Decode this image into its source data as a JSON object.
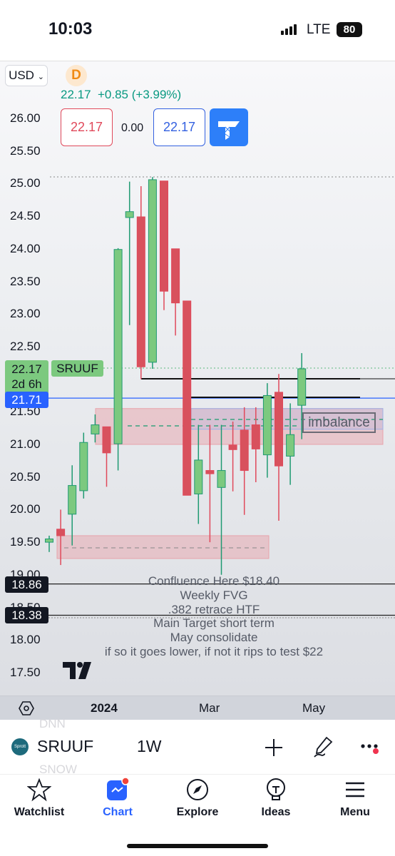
{
  "status_bar": {
    "time": "10:03",
    "network": "LTE",
    "battery": "80"
  },
  "header": {
    "currency": "USD",
    "interval_badge": "D",
    "last_price": "22.17",
    "change": "+0.85 (+3.99%)",
    "sell_price": "22.17",
    "spread": "0.00",
    "buy_price": "22.17"
  },
  "price_tags": {
    "last": "22.17",
    "countdown": "2d 6h",
    "symbol_tag": "SRUUF",
    "blue_line": "21.71",
    "level1": "18.86",
    "level2": "18.38"
  },
  "colors": {
    "up": "#7cc97f",
    "up_border": "#1f9a72",
    "down": "#d8515d",
    "accent": "#2962ff",
    "zone": "#e8a3ab"
  },
  "annotation": {
    "box_label": "imbalance",
    "note_lines": [
      "Confluence Here $18.40",
      "Weekly FVG",
      ".382 retrace HTF",
      "Main Target short term",
      "May consolidate",
      "if so it goes lower, if not it rips to test $22"
    ]
  },
  "chart_data": {
    "type": "candlestick",
    "interval": "1W",
    "y_ticks": [
      "26.00",
      "25.50",
      "25.00",
      "24.50",
      "24.00",
      "23.50",
      "23.00",
      "22.50",
      "22.00",
      "21.50",
      "21.00",
      "20.50",
      "20.00",
      "19.50",
      "19.00",
      "18.50",
      "18.00",
      "17.50"
    ],
    "ylim": [
      17.5,
      26.0
    ],
    "x_ticks": [
      "2024",
      "Mar",
      "May"
    ],
    "candles": [
      {
        "o": 19.5,
        "h": 19.6,
        "l": 19.35,
        "c": 19.55
      },
      {
        "o": 19.7,
        "h": 20.0,
        "l": 19.15,
        "c": 19.6
      },
      {
        "o": 19.93,
        "h": 20.68,
        "l": 19.45,
        "c": 20.37
      },
      {
        "o": 20.29,
        "h": 21.18,
        "l": 20.17,
        "c": 21.03
      },
      {
        "o": 21.16,
        "h": 21.46,
        "l": 21.03,
        "c": 21.3
      },
      {
        "o": 21.27,
        "h": 21.27,
        "l": 20.35,
        "c": 20.87
      },
      {
        "o": 21.01,
        "h": 24.01,
        "l": 20.6,
        "c": 23.99
      },
      {
        "o": 24.48,
        "h": 25.03,
        "l": 22.83,
        "c": 24.57
      },
      {
        "o": 24.49,
        "h": 24.96,
        "l": 22.0,
        "c": 22.19
      },
      {
        "o": 22.26,
        "h": 25.1,
        "l": 22.16,
        "c": 25.06
      },
      {
        "o": 25.04,
        "h": 25.04,
        "l": 23.06,
        "c": 23.35
      },
      {
        "o": 24.0,
        "h": 24.0,
        "l": 22.67,
        "c": 23.17
      },
      {
        "o": 23.2,
        "h": 23.2,
        "l": 20.22,
        "c": 20.22
      },
      {
        "o": 20.24,
        "h": 21.3,
        "l": 19.78,
        "c": 20.76
      },
      {
        "o": 20.6,
        "h": 21.3,
        "l": 19.5,
        "c": 20.55
      },
      {
        "o": 20.34,
        "h": 21.3,
        "l": 19.0,
        "c": 20.6
      },
      {
        "o": 20.99,
        "h": 21.35,
        "l": 20.28,
        "c": 20.92
      },
      {
        "o": 21.22,
        "h": 21.57,
        "l": 19.92,
        "c": 20.6
      },
      {
        "o": 21.3,
        "h": 21.57,
        "l": 20.42,
        "c": 20.93
      },
      {
        "o": 20.84,
        "h": 21.94,
        "l": 20.49,
        "c": 21.75
      },
      {
        "o": 21.8,
        "h": 22.08,
        "l": 19.83,
        "c": 20.67
      },
      {
        "o": 20.82,
        "h": 21.63,
        "l": 20.38,
        "c": 21.15
      },
      {
        "o": 21.6,
        "h": 22.4,
        "l": 21.08,
        "c": 22.16
      }
    ],
    "levels": [
      18.86,
      18.38
    ],
    "zones": [
      {
        "top": 21.55,
        "bottom": 21.0
      },
      {
        "top": 19.6,
        "bottom": 19.25
      }
    ]
  },
  "toolbar": {
    "symbol": "SRUUF",
    "logo_text": "Sprott",
    "interval": "1W",
    "ghost_above": "DNN",
    "ghost_below": "SNOW"
  },
  "tabs": [
    {
      "label": "Watchlist"
    },
    {
      "label": "Chart"
    },
    {
      "label": "Explore"
    },
    {
      "label": "Ideas"
    },
    {
      "label": "Menu"
    }
  ]
}
